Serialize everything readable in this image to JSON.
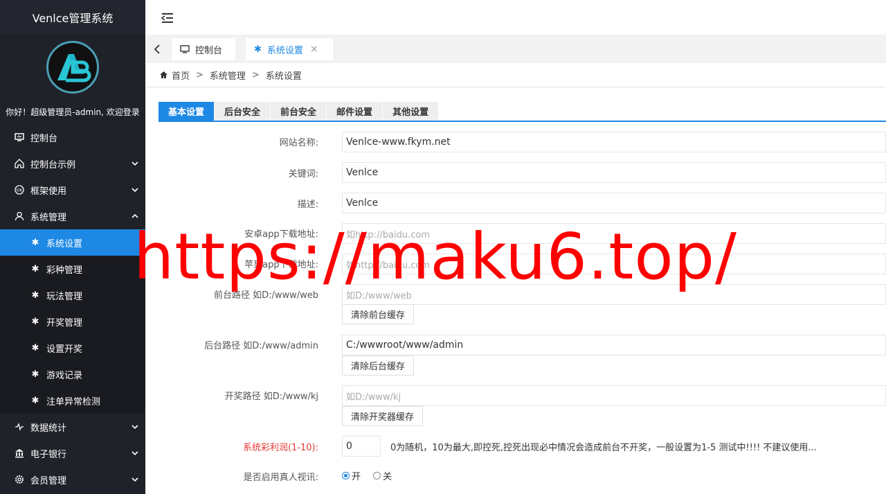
{
  "app": {
    "title": "Venlce管理系统"
  },
  "user": {
    "welcome": "你好！超级管理员-admin, 欢迎登录"
  },
  "sidebar": {
    "items": [
      {
        "label": "控制台",
        "icon": "monitor-icon",
        "arrow": ""
      },
      {
        "label": "控制台示例",
        "icon": "home-icon",
        "arrow": "down"
      },
      {
        "label": "框架使用",
        "icon": "ok-icon",
        "arrow": "down"
      },
      {
        "label": "系统管理",
        "icon": "user-icon",
        "arrow": "up"
      }
    ],
    "sub_items": [
      {
        "label": "系统设置",
        "active": true
      },
      {
        "label": "彩种管理"
      },
      {
        "label": "玩法管理"
      },
      {
        "label": "开奖管理"
      },
      {
        "label": "设置开奖"
      },
      {
        "label": "游戏记录"
      },
      {
        "label": "注单异常检测"
      }
    ],
    "bottom_items": [
      {
        "label": "数据统计",
        "icon": "pulse-icon"
      },
      {
        "label": "电子银行",
        "icon": "bank-icon"
      },
      {
        "label": "会员管理",
        "icon": "gear-icon"
      }
    ]
  },
  "tabs": [
    {
      "label": "控制台"
    },
    {
      "label": "系统设置",
      "close": "×"
    }
  ],
  "breadcrumb": {
    "home": "首页",
    "sep": ">",
    "level1": "系统管理",
    "level2": "系统设置"
  },
  "form_tabs": [
    "基本设置",
    "后台安全",
    "前台安全",
    "邮件设置",
    "其他设置"
  ],
  "form": {
    "site_name_label": "网站名称:",
    "site_name_value": "Venlce-www.fkym.net",
    "keywords_label": "关键词:",
    "keywords_value": "Venlce",
    "desc_label": "描述:",
    "desc_value": "Venlce",
    "android_label": "安卓app下载地址:",
    "android_placeholder": "如http://baidu.com",
    "ios_label": "苹果app下载地址:",
    "ios_placeholder": "如http://baidu.com",
    "front_path_label": "前台路径 如D:/www/web",
    "front_path_placeholder": "如D:/www/web",
    "clear_front_btn": "清除前台缓存",
    "admin_path_label": "后台路径 如D:/www/admin",
    "admin_path_value": "C:/wwwroot/www/admin",
    "clear_admin_btn": "清除后台缓存",
    "kj_path_label": "开奖路径 如D:/www/kj",
    "kj_path_placeholder": "如D:/www/kj",
    "clear_kj_btn": "清除开奖器缓存",
    "profit_label": "系统彩利润(1-10):",
    "profit_value": "0",
    "profit_hint": "0为随机，10为最大,即控死,控死出现必中情况会造成前台不开奖，一般设置为1-5 测试中!!!! 不建议使用...",
    "live_label": "是否启用真人视讯:",
    "live_on": "开",
    "live_off": "关"
  },
  "watermark": "https://maku6.top/",
  "colors": {
    "accent": "#1e88e5",
    "sidebar": "#20222a",
    "watermark": "#ff0000",
    "warning": "#e53935"
  }
}
